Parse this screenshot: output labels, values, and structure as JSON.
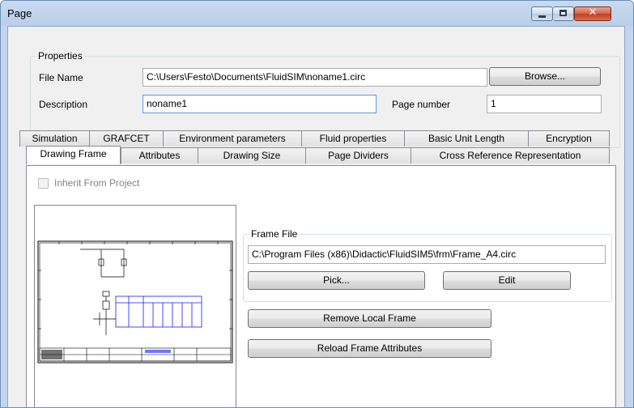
{
  "window": {
    "title": "Page"
  },
  "caption_buttons": {
    "minimize": "minimize-icon",
    "maximize": "maximize-icon",
    "close": "close-icon",
    "close_glyph": "✕"
  },
  "properties": {
    "group_label": "Properties",
    "file_name_label": "File Name",
    "file_name_value": "C:\\Users\\Festo\\Documents\\FluidSIM\\noname1.circ",
    "browse_label": "Browse...",
    "description_label": "Description",
    "description_value": "noname1",
    "page_number_label": "Page number",
    "page_number_value": "1"
  },
  "tabs": {
    "row1": [
      "Simulation",
      "GRAFCET",
      "Environment parameters",
      "Fluid properties",
      "Basic Unit Length",
      "Encryption"
    ],
    "row2": [
      "Drawing Frame",
      "Attributes",
      "Drawing Size",
      "Page Dividers",
      "Cross Reference Representation"
    ],
    "active": "Drawing Frame"
  },
  "drawing_frame": {
    "inherit_label": "Inherit From Project",
    "inherit_checked": false,
    "frame_file_group_label": "Frame File",
    "frame_file_value": "C:\\Program Files (x86)\\Didactic\\FluidSIM5\\frm\\Frame_A4.circ",
    "pick_label": "Pick...",
    "edit_label": "Edit",
    "remove_local_frame_label": "Remove Local Frame",
    "reload_frame_attributes_label": "Reload Frame Attributes"
  },
  "colors": {
    "accent_blue": "#1a1aff",
    "title_bar": "#c3d5ec",
    "close_red": "#c94a32"
  }
}
